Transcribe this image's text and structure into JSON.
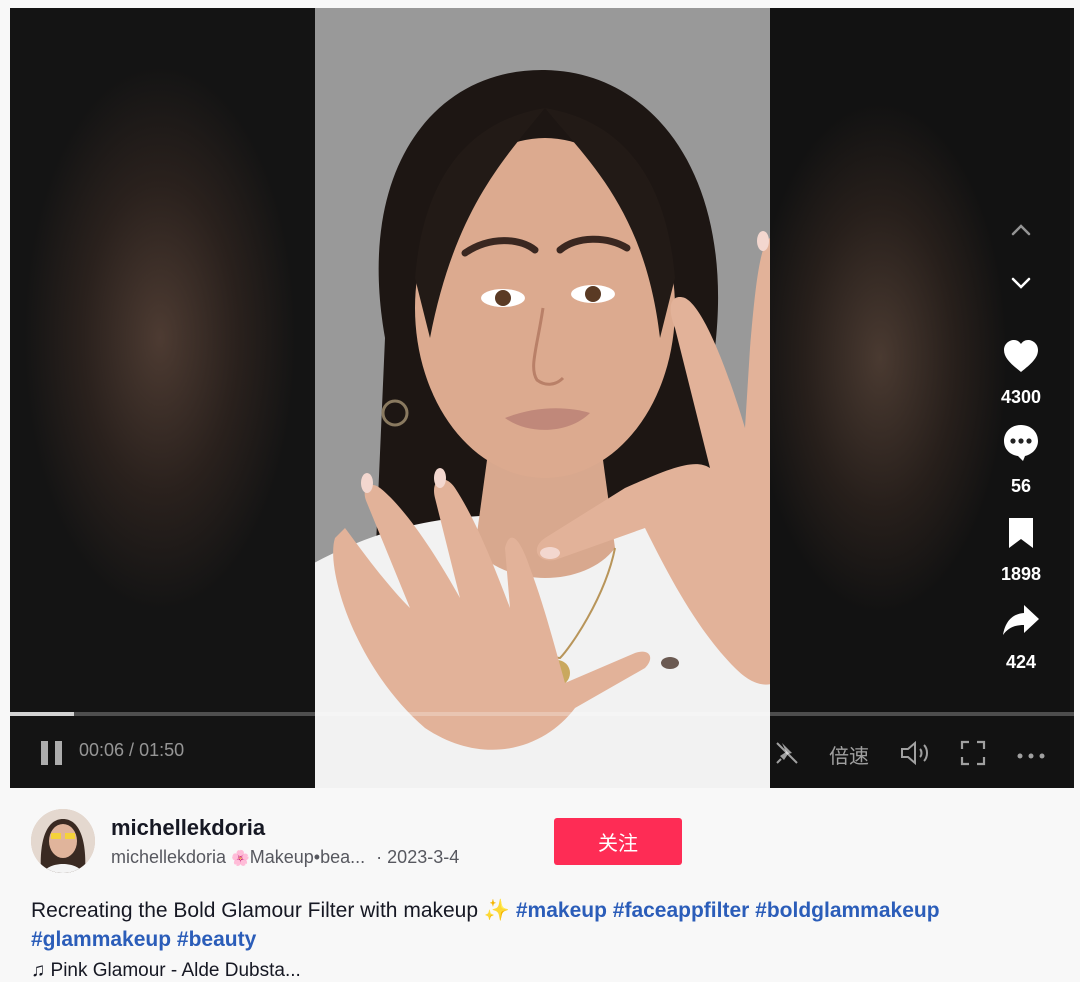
{
  "video": {
    "current_time": "00:06",
    "duration": "01:50",
    "time_separator": " / ",
    "progress_fraction": 0.06,
    "speed_label": "倍速"
  },
  "sidebar": {
    "likes": "4300",
    "comments": "56",
    "saves": "1898",
    "shares": "424"
  },
  "author": {
    "username": "michellekdoria",
    "nickname": "michellekdoria",
    "emoji": "🌸",
    "bio_preview": "Makeup•bea...",
    "separator": "·",
    "date": "2023-3-4",
    "follow_label": "关注"
  },
  "description": {
    "text": "Recreating the Bold Glamour Filter with makeup",
    "sparkle": "✨",
    "hashtags": [
      "#makeup",
      "#faceappfilter",
      "#boldglammakeup",
      "#glammakeup",
      "#beauty"
    ]
  },
  "music": {
    "note": "♫",
    "title": "Pink Glamour - Alde Dubsta..."
  },
  "colors": {
    "accent": "#fe2c55",
    "hashtag": "#2b5db9"
  },
  "icons": [
    "chevron-up-icon",
    "chevron-down-icon",
    "heart-icon",
    "comment-icon",
    "bookmark-icon",
    "share-icon",
    "pause-icon",
    "mute-pin-icon",
    "volume-icon",
    "fullscreen-icon",
    "more-icon"
  ]
}
